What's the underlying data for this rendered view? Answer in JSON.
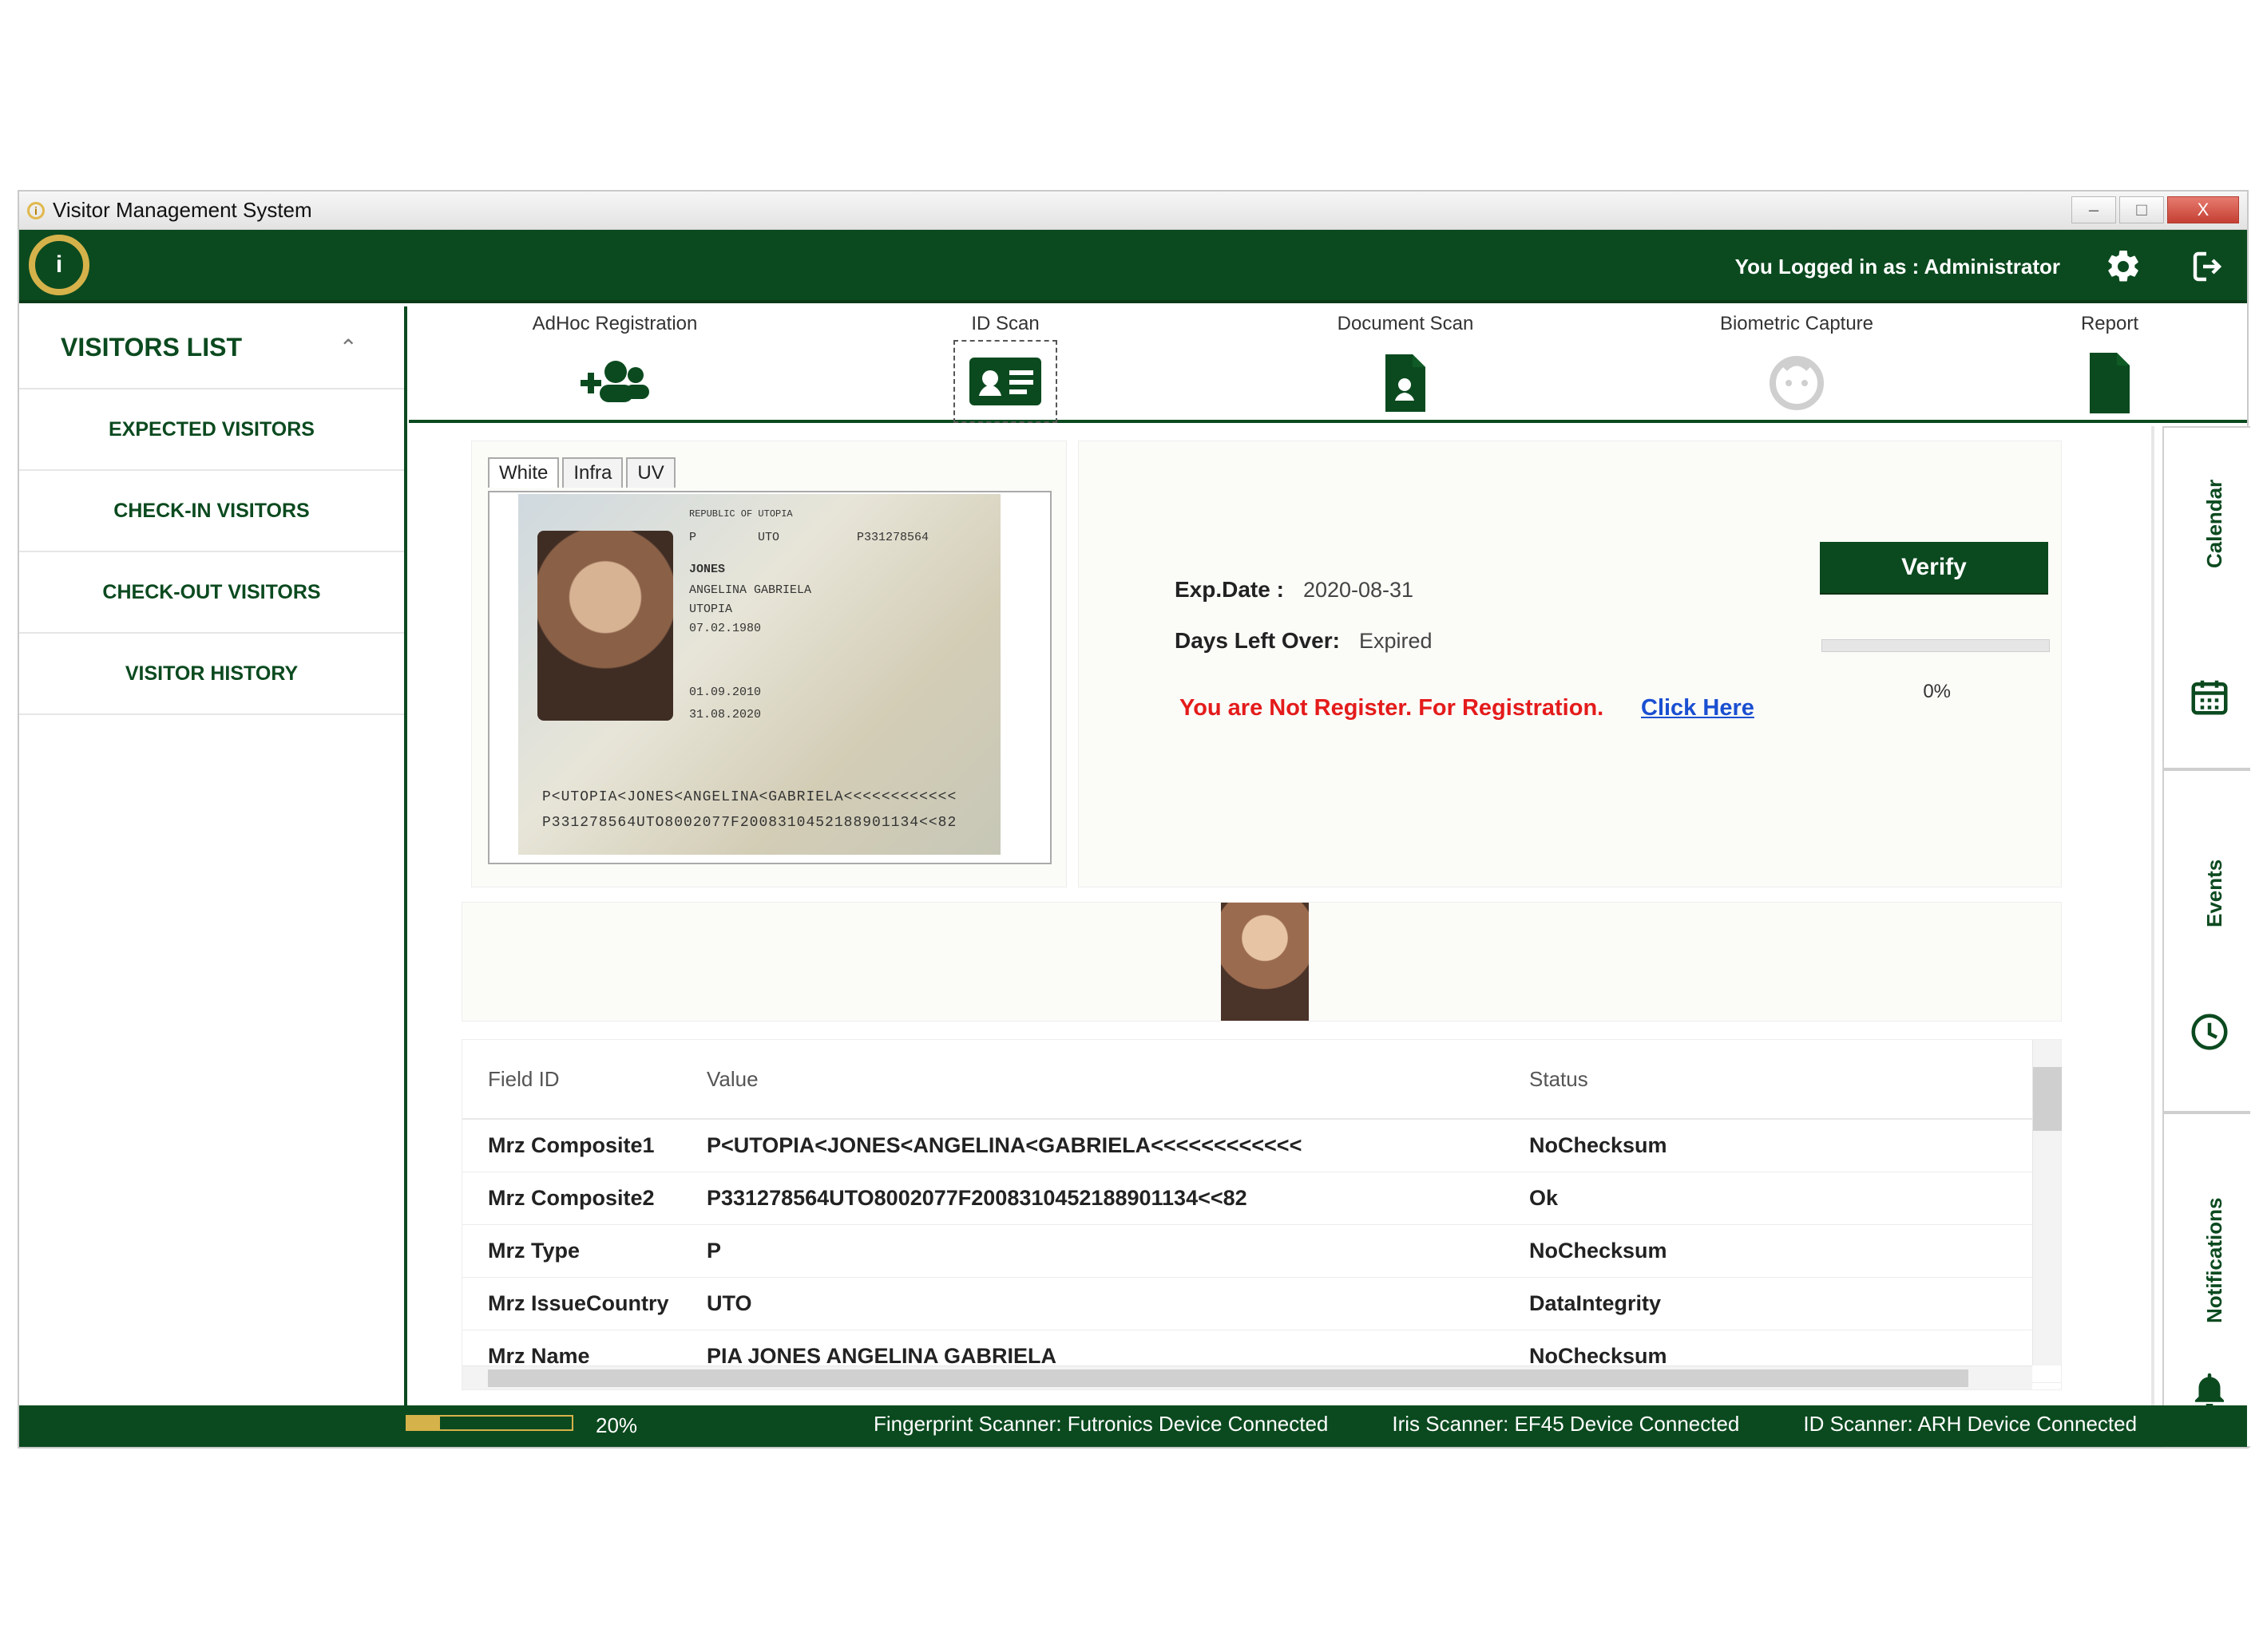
{
  "app": {
    "title": "Visitor Management System",
    "logged_in": "You Logged in as : Administrator"
  },
  "window_controls": {
    "minimize": "–",
    "maximize": "□",
    "close": "X"
  },
  "sidebar": {
    "title": "VISITORS LIST",
    "items": [
      "EXPECTED VISITORS",
      "CHECK-IN VISITORS",
      "CHECK-OUT VISITORS",
      "VISITOR HISTORY"
    ]
  },
  "tabs": [
    {
      "label": "AdHoc Registration",
      "icon": "add-users-icon"
    },
    {
      "label": "ID Scan",
      "icon": "id-card-icon"
    },
    {
      "label": "Document Scan",
      "icon": "document-user-icon"
    },
    {
      "label": "Biometric Capture",
      "icon": "face-icon"
    },
    {
      "label": "Report",
      "icon": "report-file-icon"
    }
  ],
  "document_viewer": {
    "tabs": [
      "White",
      "Infra",
      "UV"
    ],
    "passport": {
      "republic": "REPUBLIC OF UTOPIA",
      "type": "P",
      "country": "UTO",
      "number": "P331278564",
      "surname": "JONES",
      "given_names": "ANGELINA GABRIELA",
      "nationality": "UTOPIA",
      "dob": "07.02.1980",
      "issue": "01.09.2010",
      "expiry": "31.08.2020",
      "mrz1": "P<UTOPIA<JONES<ANGELINA<GABRIELA<<<<<<<<<<<<",
      "mrz2": "P331278564UTO8002077F2008310452188901134<<82"
    }
  },
  "details": {
    "exp_label": "Exp.Date :",
    "exp_value": "2020-08-31",
    "days_label": "Days Left Over:",
    "days_value": "Expired",
    "not_registered": "You are Not Register. For Registration.",
    "click_here": "Click Here",
    "verify_button": "Verify",
    "progress_fraction": 0.0,
    "progress_text": "0%"
  },
  "table": {
    "headers": [
      "Field ID",
      "Value",
      "Status"
    ],
    "rows": [
      [
        "Mrz Composite1",
        "P<UTOPIA<JONES<ANGELINA<GABRIELA<<<<<<<<<<<<",
        "NoChecksum"
      ],
      [
        "Mrz Composite2",
        "P331278564UTO8002077F2008310452188901134<<82",
        "Ok"
      ],
      [
        "Mrz Type",
        "P",
        "NoChecksum"
      ],
      [
        "Mrz IssueCountry",
        "UTO",
        "DataIntegrity"
      ],
      [
        "Mrz Name",
        "PIA JONES ANGELINA GABRIELA",
        "NoChecksum"
      ]
    ]
  },
  "rightbar": {
    "calendar": "Calendar",
    "events": "Events",
    "notifications": "Notifications"
  },
  "status_bar": {
    "progress_fraction": 0.2,
    "progress_text": "20%",
    "fingerprint": "Fingerprint Scanner: Futronics Device Connected",
    "iris": "Iris Scanner: EF45 Device Connected",
    "id_scanner": "ID Scanner: ARH Device Connected"
  },
  "colors": {
    "primary_green": "#0b4a1f",
    "accent_gold": "#d6b24a",
    "error_red": "#e41b1b",
    "link_blue": "#1a4fd1"
  }
}
